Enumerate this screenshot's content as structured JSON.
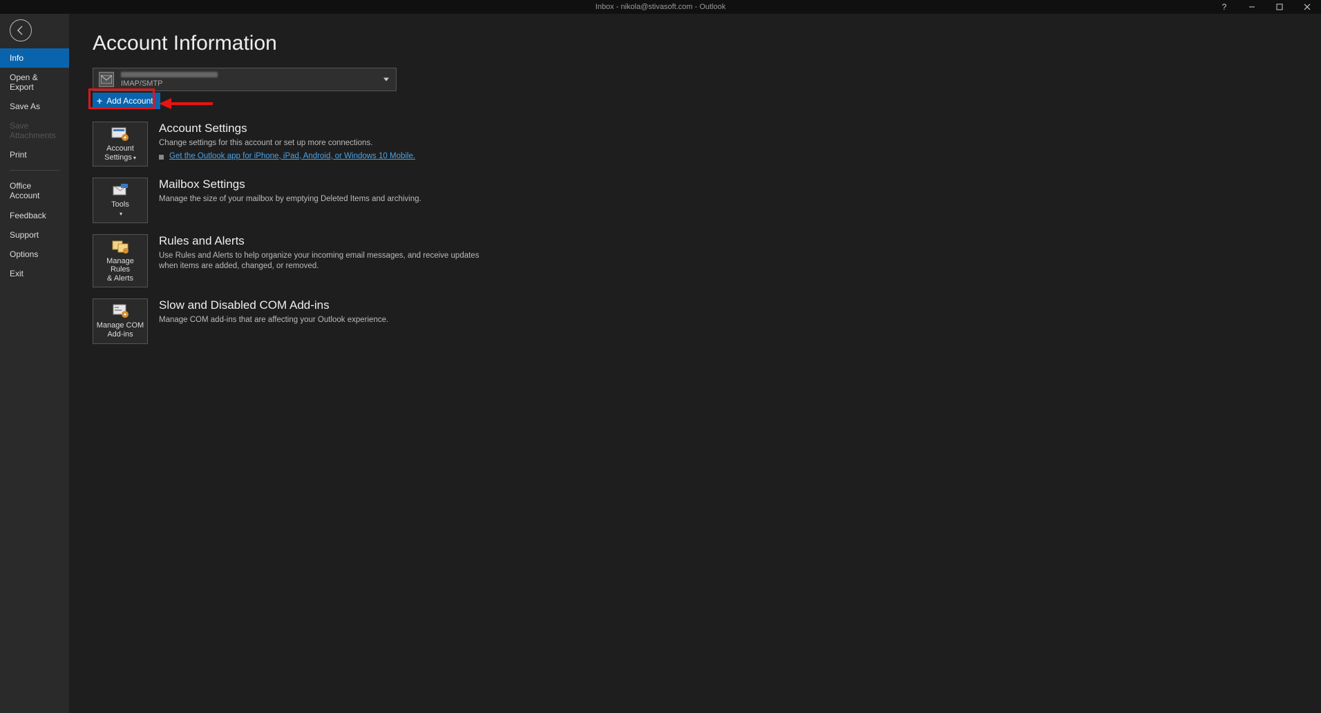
{
  "titlebar": {
    "title": "Inbox - nikola@stivasoft.com  -  Outlook"
  },
  "nav": {
    "info": "Info",
    "open_export": "Open & Export",
    "save_as": "Save As",
    "save_attachments": "Save Attachments",
    "print": "Print",
    "office_account": "Office\nAccount",
    "feedback": "Feedback",
    "support": "Support",
    "options": "Options",
    "exit": "Exit"
  },
  "page": {
    "title": "Account Information"
  },
  "account": {
    "type": "IMAP/SMTP",
    "add_account": "Add Account"
  },
  "sections": {
    "settings": {
      "title": "Account Settings",
      "desc": "Change settings for this account or set up more connections.",
      "link": "Get the Outlook app for iPhone, iPad, Android, or Windows 10 Mobile.",
      "tile": "Account\nSettings"
    },
    "mailbox": {
      "title": "Mailbox Settings",
      "desc": "Manage the size of your mailbox by emptying Deleted Items and archiving.",
      "tile": "Tools"
    },
    "rules": {
      "title": "Rules and Alerts",
      "desc": "Use Rules and Alerts to help organize your incoming email messages, and receive updates when items are added, changed, or removed.",
      "tile": "Manage Rules\n& Alerts"
    },
    "com": {
      "title": "Slow and Disabled COM Add-ins",
      "desc": "Manage COM add-ins that are affecting your Outlook experience.",
      "tile": "Manage COM\nAdd-ins"
    }
  }
}
